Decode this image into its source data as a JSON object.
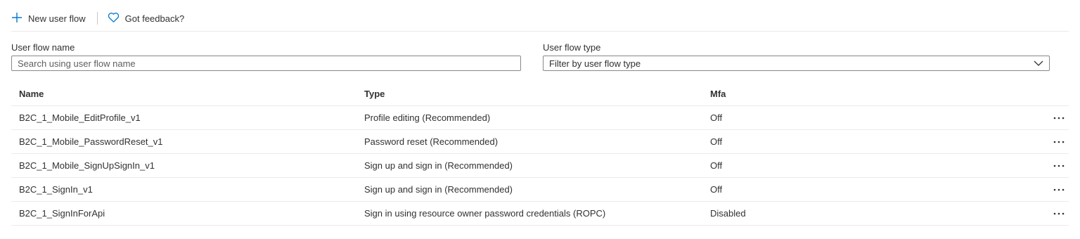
{
  "toolbar": {
    "new_user_flow": "New user flow",
    "feedback": "Got feedback?"
  },
  "filters": {
    "name_label": "User flow name",
    "name_placeholder": "Search using user flow name",
    "type_label": "User flow type",
    "type_value": "Filter by user flow type"
  },
  "table": {
    "columns": [
      "Name",
      "Type",
      "Mfa"
    ],
    "rows": [
      {
        "name": "B2C_1_Mobile_EditProfile_v1",
        "type": "Profile editing (Recommended)",
        "mfa": "Off"
      },
      {
        "name": "B2C_1_Mobile_PasswordReset_v1",
        "type": "Password reset (Recommended)",
        "mfa": "Off"
      },
      {
        "name": "B2C_1_Mobile_SignUpSignIn_v1",
        "type": "Sign up and sign in (Recommended)",
        "mfa": "Off"
      },
      {
        "name": "B2C_1_SignIn_v1",
        "type": "Sign up and sign in (Recommended)",
        "mfa": "Off"
      },
      {
        "name": "B2C_1_SignInForApi",
        "type": "Sign in using resource owner password credentials (ROPC)",
        "mfa": "Disabled"
      }
    ]
  },
  "colors": {
    "accent": "#0078d4",
    "border": "#8a8886",
    "divider": "#edebe9"
  },
  "icons": {
    "add": "plus-icon",
    "feedback": "heart-icon",
    "dropdown": "chevron-down-icon",
    "more": "more-icon"
  }
}
